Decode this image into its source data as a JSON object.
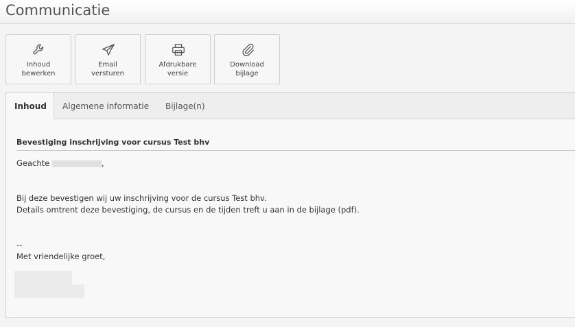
{
  "page": {
    "title": "Communicatie"
  },
  "toolbar": {
    "edit": {
      "line1": "Inhoud",
      "line2": "bewerken",
      "icon": "wrench-icon"
    },
    "email": {
      "line1": "Email",
      "line2": "versturen",
      "icon": "paper-plane-icon"
    },
    "print": {
      "line1": "Afdrukbare",
      "line2": "versie",
      "icon": "printer-icon"
    },
    "download": {
      "line1": "Download",
      "line2": "bijlage",
      "icon": "paperclip-icon"
    }
  },
  "tabs": [
    {
      "label": "Inhoud",
      "active": true
    },
    {
      "label": "Algemene informatie",
      "active": false
    },
    {
      "label": "Bijlage(n)",
      "active": false
    }
  ],
  "message": {
    "subject": "Bevestiging inschrijving voor cursus Test bhv",
    "greeting_prefix": "Geachte",
    "greeting_suffix": ",",
    "body_line1": "Bij deze bevestigen wij uw inschrijving voor de cursus Test bhv.",
    "body_line2": "Details omtrent deze bevestiging, de cursus en de tijden treft u aan in de bijlage (pdf).",
    "separator": "--",
    "closing": "Met vriendelijke groet,"
  },
  "colors": {
    "background": "#f4f4f4",
    "border": "#cfcfcf",
    "text": "#333333"
  }
}
